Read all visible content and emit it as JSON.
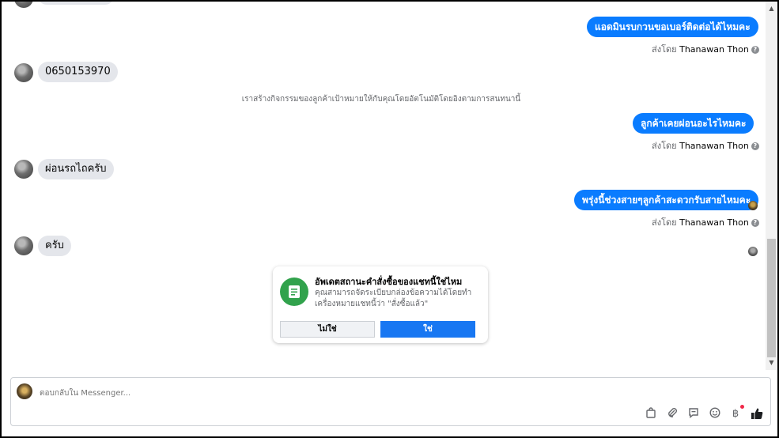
{
  "conversation": {
    "messages": [
      {
        "kind": "out",
        "text": "แอดมินรบกวนขอเบอร์ติดต่อได้ไหมคะ",
        "sent_by_prefix": "ส่งโดย",
        "sent_by_name": "Thanawan Thon"
      },
      {
        "kind": "in",
        "text": "0650153970"
      },
      {
        "kind": "system",
        "text": "เราสร้างกิจกรรมของลูกค้าเป้าหมายให้กับคุณโดยอัตโนมัติโดยอิงตามการสนทนานี้"
      },
      {
        "kind": "out",
        "text": "ลูกค้าเคยผ่อนอะไรไหมคะ",
        "sent_by_prefix": "ส่งโดย",
        "sent_by_name": "Thanawan Thon"
      },
      {
        "kind": "in",
        "text": "ผ่อนรถไถครับ"
      },
      {
        "kind": "out",
        "text": "พรุ่งนี้ช่วงสายๆลูกค้าสะดวกรับสายไหมคะ",
        "sent_by_prefix": "ส่งโดย",
        "sent_by_name": "Thanawan Thon"
      },
      {
        "kind": "in",
        "text": "ครับ"
      }
    ]
  },
  "order_card": {
    "title": "อัพเดตสถานะคำสั่งซื้อของแชทนี้ใช่ไหม",
    "description": "คุณสามารถจัดระเบียบกล่องข้อความได้โดยทำเครื่องหมายแชทนี้ว่า \"สั่งซื้อแล้ว\"",
    "no_label": "ไม่ใช่",
    "yes_label": "ใช่",
    "icon": "receipt-icon",
    "icon_color": "#31a24c"
  },
  "composer": {
    "placeholder": "ตอบกลับใน Messenger...",
    "tools": [
      "bag-icon",
      "paperclip-icon",
      "saved-reply-icon",
      "emoji-icon",
      "baht-icon",
      "like-icon"
    ]
  },
  "colors": {
    "outgoing_bubble": "#0a7cff",
    "incoming_bubble": "#e4e6eb",
    "primary_button": "#1877f2"
  }
}
